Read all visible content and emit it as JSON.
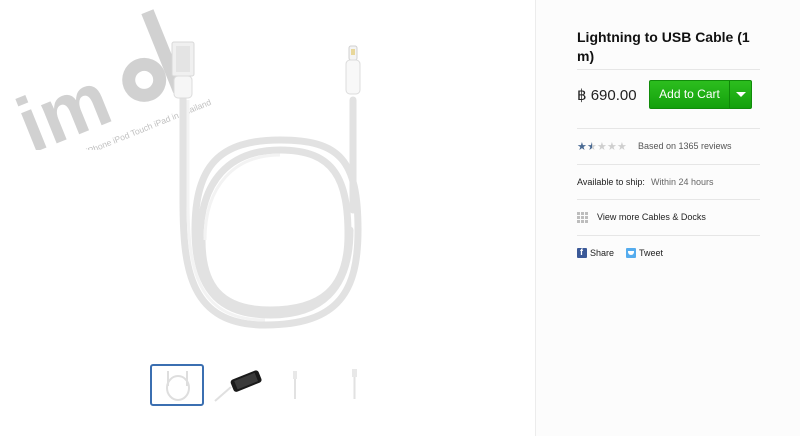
{
  "watermark": {
    "logo_text": "imod",
    "tagline": "All Things iPhone iPod Touch iPad in Thailand"
  },
  "product": {
    "title": "Lightning to USB Cable (1 m)",
    "price": "฿ 690.00",
    "add_to_cart_label": "Add to Cart",
    "rating": {
      "value": 1.5,
      "max": 5
    },
    "reviews_text": "Based on 1365 reviews",
    "ship_label": "Available to ship:",
    "ship_value": "Within 24 hours",
    "more_link": "View more Cables & Docks",
    "share_label": "Share",
    "tweet_label": "Tweet"
  },
  "gallery": {
    "selected_index": 0,
    "thumbnails": [
      "cable-coiled",
      "cable-with-iphone",
      "connector-lightning",
      "connector-usb"
    ]
  },
  "colors": {
    "accent_blue": "#3b6fb1",
    "cart_green": "#1bb012",
    "star_blue": "#4a6a93"
  }
}
